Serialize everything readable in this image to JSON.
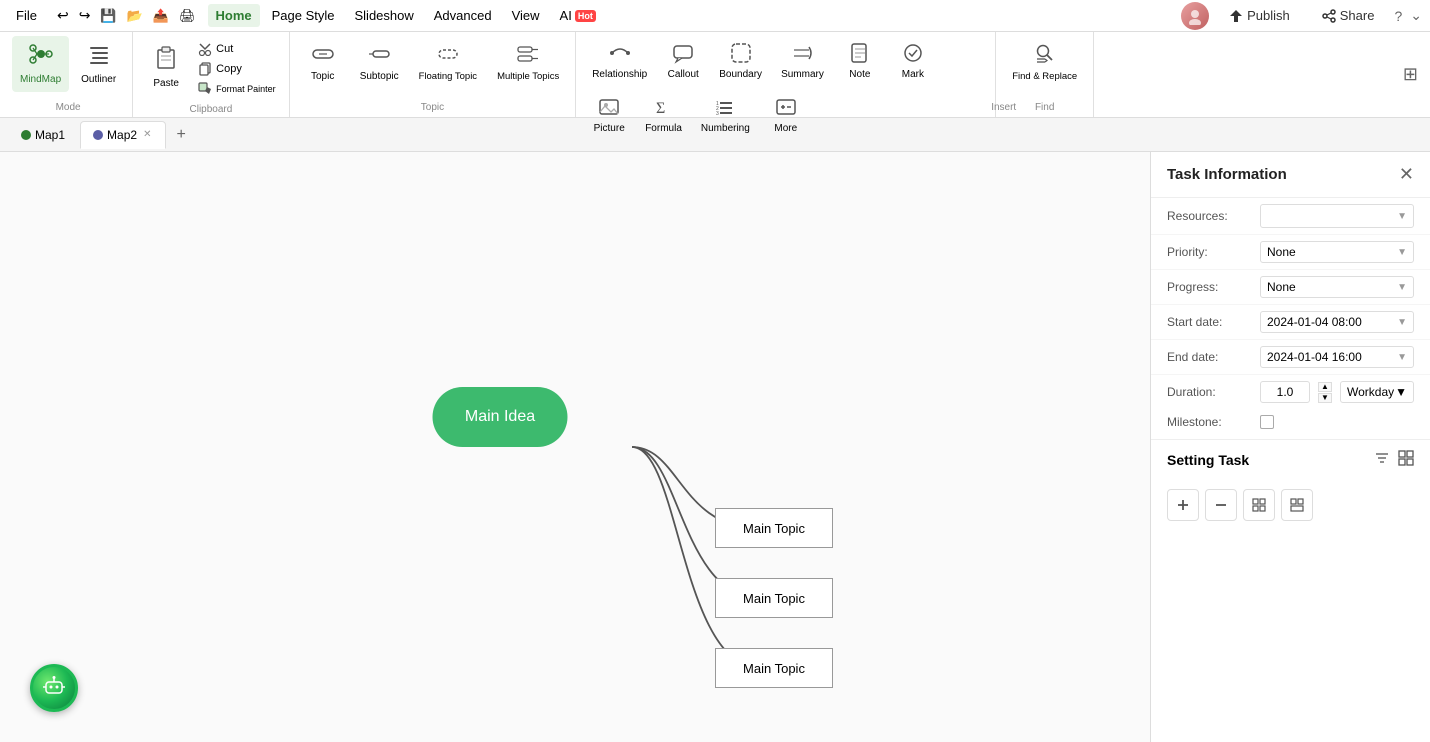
{
  "menu": {
    "file": "File",
    "home": "Home",
    "page_style": "Page Style",
    "slideshow": "Slideshow",
    "advanced": "Advanced",
    "view": "View",
    "ai": "AI",
    "hot_badge": "Hot",
    "publish": "Publish",
    "share": "Share",
    "undo_icon": "↩",
    "redo_icon": "↪",
    "save_icon": "💾",
    "open_icon": "📂",
    "export_icon": "📤",
    "print_icon": "🖨",
    "share_icon": "🔗"
  },
  "ribbon": {
    "mode_label": "Mode",
    "mindmap_label": "MindMap",
    "outliner_label": "Outliner",
    "clipboard_label": "Clipboard",
    "paste_label": "Paste",
    "cut_label": "Cut",
    "copy_label": "Copy",
    "format_painter_label": "Format\nPainter",
    "topic_group_label": "Topic",
    "topic_label": "Topic",
    "subtopic_label": "Subtopic",
    "floating_topic_label": "Floating\nTopic",
    "multiple_topics_label": "Multiple\nTopics",
    "insert_label": "Insert",
    "relationship_label": "Relationship",
    "callout_label": "Callout",
    "boundary_label": "Boundary",
    "summary_label": "Summary",
    "note_label": "Note",
    "mark_label": "Mark",
    "picture_label": "Picture",
    "formula_label": "Formula",
    "numbering_label": "Numbering",
    "more_label": "More",
    "find_label": "Find",
    "find_replace_label": "Find &\nReplace"
  },
  "tabs": {
    "tab1": "Map1",
    "tab2": "Map2",
    "add_label": "+"
  },
  "canvas": {
    "central_node_text": "Main Idea",
    "topic1_text": "Main Topic",
    "topic2_text": "Main Topic",
    "topic3_text": "Main Topic"
  },
  "side_panel": {
    "title": "Task Information",
    "resources_label": "Resources:",
    "resources_value": "",
    "priority_label": "Priority:",
    "priority_value": "None",
    "progress_label": "Progress:",
    "progress_value": "None",
    "start_date_label": "Start date:",
    "start_date_value": "2024-01-04  08:00",
    "end_date_label": "End date:",
    "end_date_value": "2024-01-04  16:00",
    "duration_label": "Duration:",
    "duration_value": "1.0",
    "workday_value": "Workday",
    "milestone_label": "Milestone:",
    "setting_task_label": "Setting Task"
  }
}
